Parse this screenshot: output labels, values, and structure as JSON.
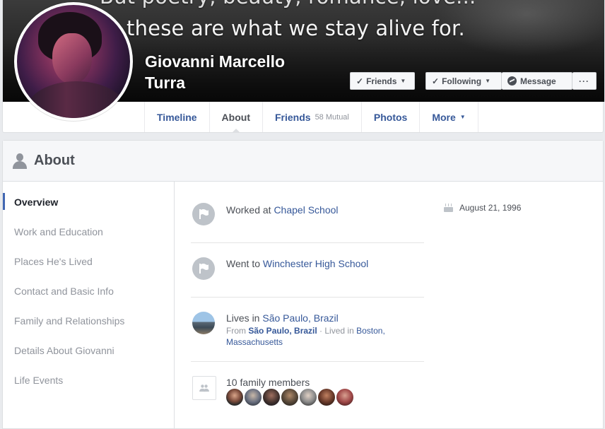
{
  "cover": {
    "quote_line1": "But poetry, beauty, romance, love...",
    "quote_line2": "these are what we stay alive for."
  },
  "profile": {
    "name": "Giovanni Marcello Turra"
  },
  "header_buttons": {
    "friends": "Friends",
    "following": "Following",
    "message": "Message",
    "more": "···"
  },
  "tabs": [
    {
      "label": "Timeline",
      "sub": ""
    },
    {
      "label": "About",
      "sub": ""
    },
    {
      "label": "Friends",
      "sub": "58 Mutual"
    },
    {
      "label": "Photos",
      "sub": ""
    },
    {
      "label": "More",
      "sub": ""
    }
  ],
  "about": {
    "title": "About",
    "nav": [
      "Overview",
      "Work and Education",
      "Places He's Lived",
      "Contact and Basic Info",
      "Family and Relationships",
      "Details About Giovanni",
      "Life Events"
    ],
    "work": {
      "prefix": "Worked at",
      "place": "Chapel School"
    },
    "education": {
      "prefix": "Went to",
      "place": "Winchester High School"
    },
    "lives": {
      "prefix": "Lives in",
      "place": "São Paulo, Brazil",
      "from_prefix": "From",
      "from_place": "São Paulo, Brazil",
      "lived_prefix": "· Lived in",
      "lived_place": "Boston, Massachusetts"
    },
    "family": {
      "label": "10 family members"
    },
    "birthday": "August 21, 1996"
  },
  "colors": {
    "link": "#365899",
    "accent": "#4267b2",
    "muted": "#90949c"
  }
}
